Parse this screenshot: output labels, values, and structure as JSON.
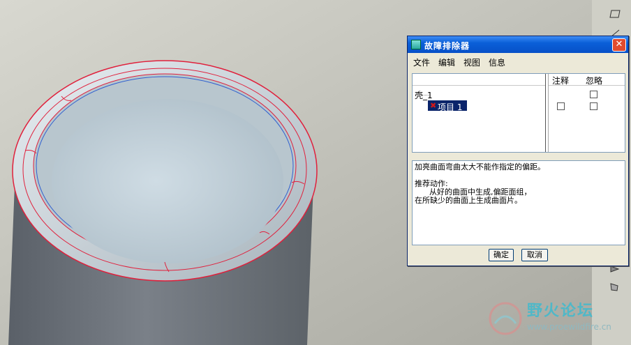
{
  "dialog": {
    "title": "故障排除器",
    "close_glyph": "✕",
    "menu": [
      "文件",
      "编辑",
      "视图",
      "信息"
    ],
    "columns": {
      "annotate": "注释",
      "ignore": "忽略"
    },
    "tree": {
      "root_label": "壳_1",
      "child_label": "项目 1",
      "error_glyph": "✖"
    },
    "message": {
      "line1": "加亮曲面弯曲太大不能作指定的偏距。",
      "line2": "推荐动作:",
      "line3": "      从好的曲面中生成,偏距面组，",
      "line4": "在所缺少的曲面上生成曲面片。"
    },
    "buttons": {
      "ok": "确定",
      "cancel": "取消"
    }
  },
  "watermark": {
    "name": "野火论坛",
    "url": "www.proewildfire.cn"
  },
  "colors": {
    "title_bar": "#0a5fd8",
    "edge_highlight": "#e0203c",
    "model_surface": "#c9d8e0"
  }
}
